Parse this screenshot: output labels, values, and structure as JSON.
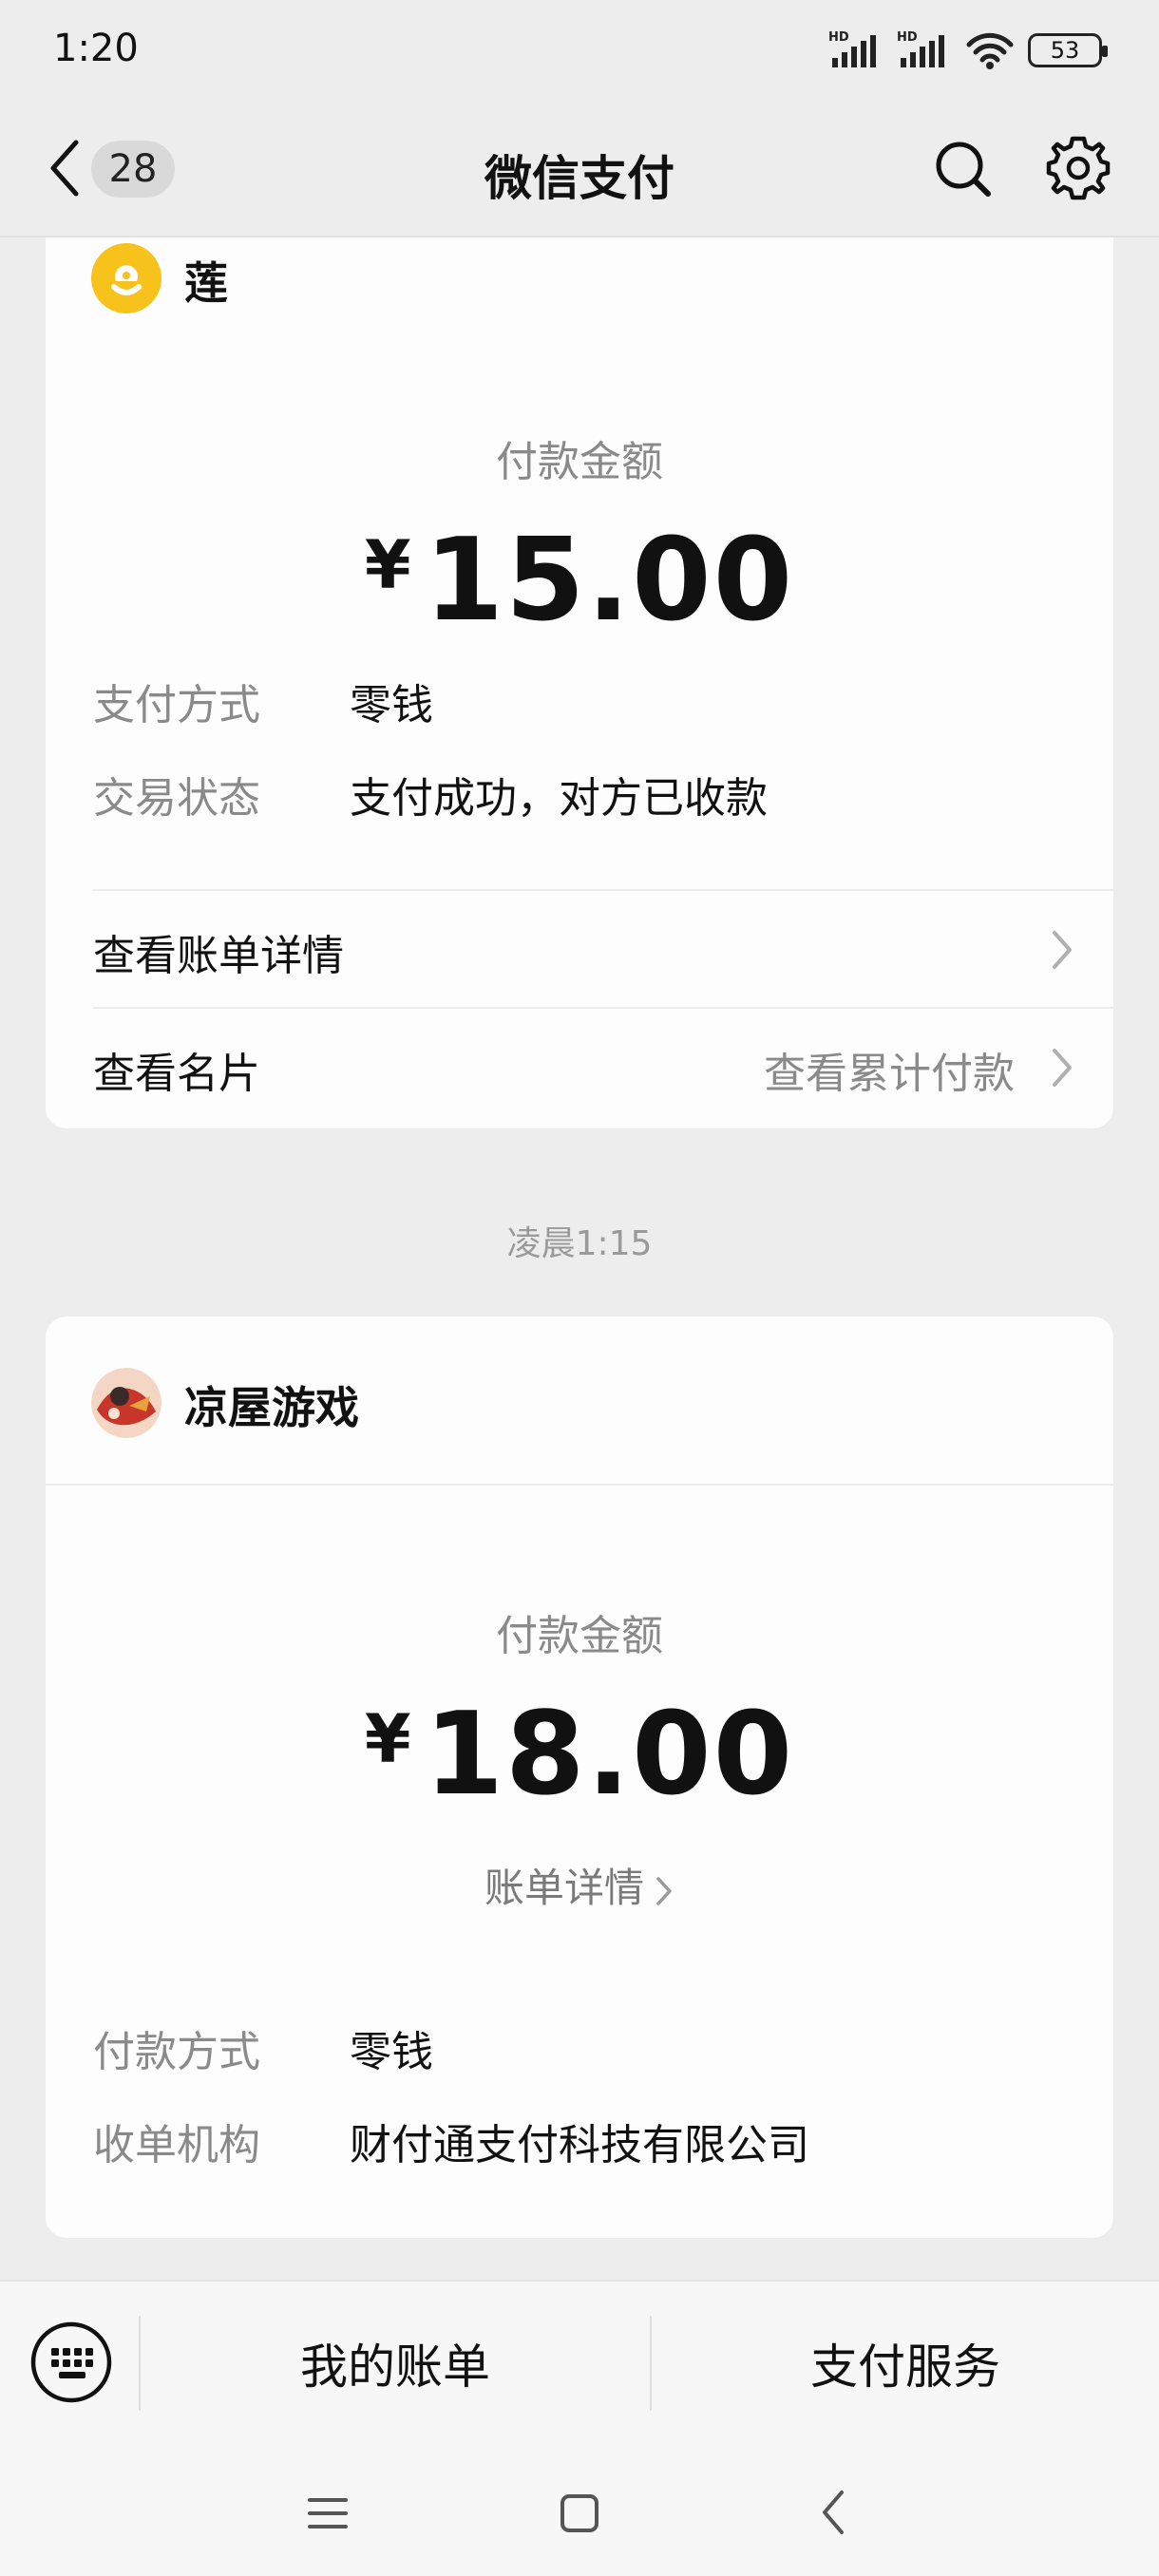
{
  "status_bar": {
    "time": "1:20",
    "battery": "53",
    "signal_label_1": "HD",
    "signal_label_2": "HD"
  },
  "header": {
    "unread_count": "28",
    "title": "微信支付",
    "icons": [
      "back-icon",
      "search-icon",
      "gear-icon"
    ]
  },
  "card1": {
    "merchant": "莲",
    "amount_label": "付款金额",
    "currency": "¥",
    "amount": "15.00",
    "details": [
      {
        "label": "支付方式",
        "value": "零钱"
      },
      {
        "label": "交易状态",
        "value": "支付成功，对方已收款"
      }
    ],
    "links": {
      "bill_detail": "查看账单详情",
      "business_card": "查看名片",
      "cumulative": "查看累计付款"
    }
  },
  "timestamp": "凌晨1:15",
  "card2": {
    "merchant": "凉屋游戏",
    "amount_label": "付款金额",
    "currency": "¥",
    "amount": "18.00",
    "bill_link": "账单详情",
    "details": [
      {
        "label": "付款方式",
        "value": "零钱"
      },
      {
        "label": "收单机构",
        "value": "财付通支付科技有限公司"
      }
    ]
  },
  "bottom_bar": {
    "my_bills": "我的账单",
    "pay_services": "支付服务"
  },
  "colors": {
    "background": "#ededed",
    "card": "#fdfdfd",
    "muted_text": "#8a8a8a",
    "avatar_yellow": "#f7c21b"
  }
}
